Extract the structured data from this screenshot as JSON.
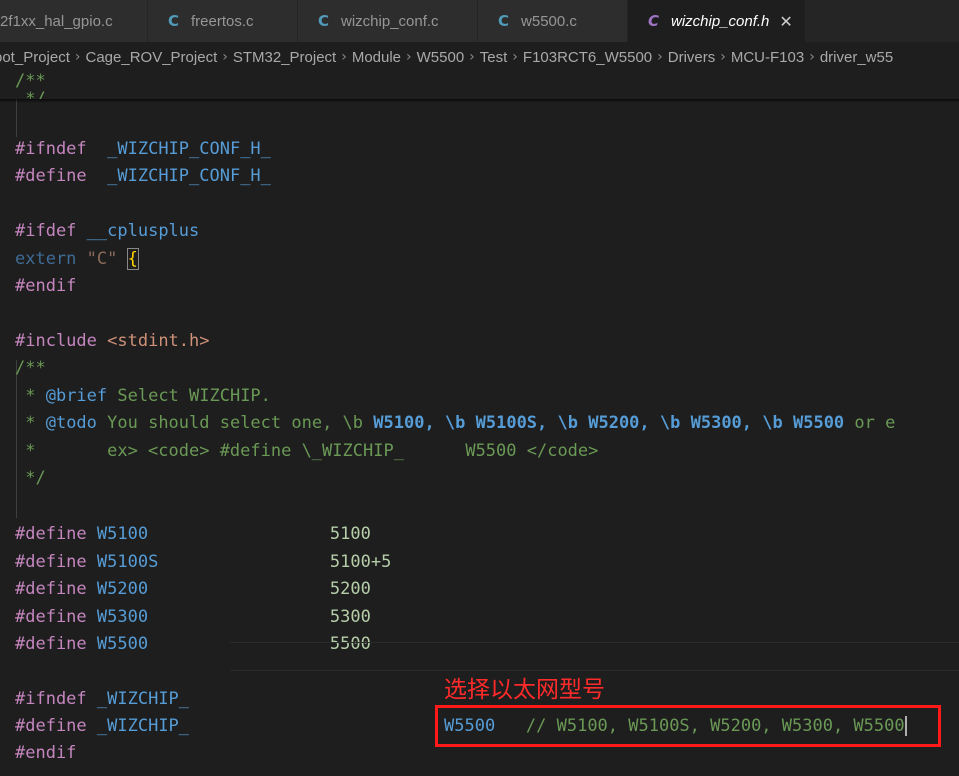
{
  "tabs": [
    {
      "icon": "",
      "label": "2f1xx_hal_gpio.c",
      "active": false
    },
    {
      "icon": "C",
      "label": "freertos.c",
      "active": false
    },
    {
      "icon": "C",
      "label": "wizchip_conf.c",
      "active": false
    },
    {
      "icon": "C",
      "label": "w5500.c",
      "active": false
    },
    {
      "icon": "C",
      "label": "wizchip_conf.h",
      "active": true
    }
  ],
  "close_glyph": "✕",
  "breadcrumb": [
    "oot_Project",
    "Cage_ROV_Project",
    "STM32_Project",
    "Module",
    "W5500",
    "Test",
    "F103RCT6_W5500",
    "Drivers",
    "MCU-F103",
    "driver_w55"
  ],
  "breadcrumb_sep": "›",
  "code": {
    "l0": "/**",
    "l1": " */",
    "ifndef_kw": "#ifndef",
    "ifndef_name": "_WIZCHIP_CONF_H_",
    "define_kw": "#define",
    "define_name": "_WIZCHIP_CONF_H_",
    "ifdef_kw": "#ifdef",
    "ifdef_name": "__cplusplus",
    "extern_kw": "extern",
    "extern_str": "\"C\"",
    "extern_brace": "{",
    "endif1": "#endif",
    "include_kw": "#include",
    "include_hdr": "<stdint.h>",
    "doc_open": "/**",
    "brief_star": " * ",
    "brief_tag": "@brief",
    "brief_text": " Select WIZCHIP.",
    "todo_star": " * ",
    "todo_tag": "@todo",
    "todo_text_a": " You should select one, \\b ",
    "todo_w1": "W5100",
    "todo_c1": ", \\b ",
    "todo_w2": "W5100S",
    "todo_c2": ", \\b ",
    "todo_w3": "W5200",
    "todo_c3": ", \\b ",
    "todo_w4": "W5300",
    "todo_c4": ", \\b ",
    "todo_w5": "W5500",
    "todo_tail": " or e",
    "ex_line": " *       ex> <code> #define \\_WIZCHIP_      W5500 </code>",
    "doc_close": " */",
    "defines": [
      {
        "kw": "#define",
        "name": "W5100",
        "value": "5100"
      },
      {
        "kw": "#define",
        "name": "W5100S",
        "value": "5100+5"
      },
      {
        "kw": "#define",
        "name": "W5200",
        "value": "5200"
      },
      {
        "kw": "#define",
        "name": "W5300",
        "value": "5300"
      },
      {
        "kw": "#define",
        "name": "W5500",
        "value": "5500"
      }
    ],
    "ifndef2_kw": "#ifndef",
    "ifndef2_name": "_WIZCHIP_",
    "define2_kw": "#define",
    "define2_name": "_WIZCHIP_",
    "define2_value": "W5500",
    "define2_comment": "// W5100, W5100S, W5200, W5300, W5500",
    "endif2": "#endif"
  },
  "annotation": {
    "text": "选择以太网型号",
    "color": "#ff2a2a"
  },
  "colors": {
    "preprocessor": "#c586c0",
    "macro": "#569cd6",
    "comment": "#6a9955",
    "string": "#ce9178",
    "number": "#b5cea8"
  }
}
